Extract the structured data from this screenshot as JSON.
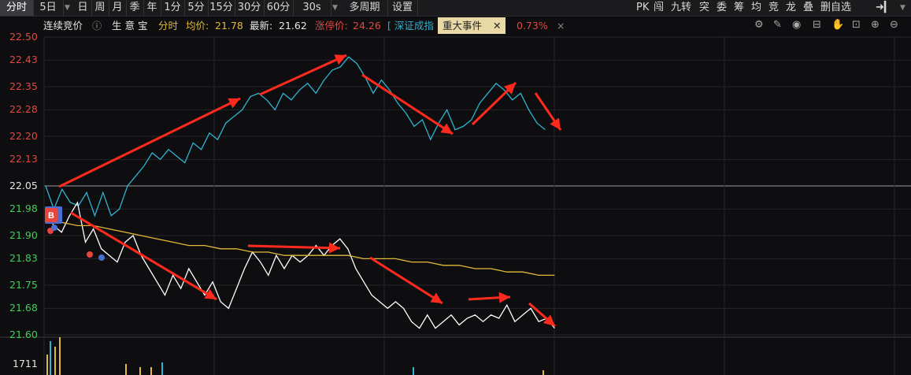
{
  "tabs": [
    {
      "label": "分时",
      "active": true
    },
    {
      "label": "5日",
      "active": false,
      "dropdown": true
    },
    {
      "label": "日",
      "active": false
    },
    {
      "label": "周",
      "active": false
    },
    {
      "label": "月",
      "active": false
    },
    {
      "label": "季",
      "active": false
    },
    {
      "label": "年",
      "active": false
    },
    {
      "label": "1分",
      "active": false
    },
    {
      "label": "5分",
      "active": false
    },
    {
      "label": "15分",
      "active": false
    },
    {
      "label": "30分",
      "active": false
    },
    {
      "label": "60分",
      "active": false
    },
    {
      "label": "30s",
      "active": false,
      "dropdown": true
    },
    {
      "label": "多周期",
      "active": false
    },
    {
      "label": "设置",
      "active": false
    }
  ],
  "right_tools": [
    "PK",
    "闯",
    "九转",
    "突",
    "委",
    "筹",
    "均",
    "竞",
    "龙",
    "叠",
    "删自选"
  ],
  "info": {
    "auction": "连续竞价",
    "life_sign": "生 意 宝",
    "mode": "分时",
    "avg_label": "均价:",
    "avg_value": "21.78",
    "last_label": "最新:",
    "last_value": "21.62",
    "limit_label": "涨停价:",
    "limit_value": "24.26",
    "index_link": "[ 深证成指",
    "event_label": "重大事件",
    "index_change": "0.73%"
  },
  "y_ticks": [
    {
      "v": "22.50",
      "color": "#e8453c"
    },
    {
      "v": "22.43",
      "color": "#e8453c"
    },
    {
      "v": "22.35",
      "color": "#e8453c"
    },
    {
      "v": "22.28",
      "color": "#e8453c"
    },
    {
      "v": "22.20",
      "color": "#e8453c"
    },
    {
      "v": "22.13",
      "color": "#e8453c"
    },
    {
      "v": "22.05",
      "color": "#e6e6e6"
    },
    {
      "v": "21.98",
      "color": "#3fcf5a"
    },
    {
      "v": "21.90",
      "color": "#3fcf5a"
    },
    {
      "v": "21.83",
      "color": "#3fcf5a"
    },
    {
      "v": "21.75",
      "color": "#3fcf5a"
    },
    {
      "v": "21.68",
      "color": "#3fcf5a"
    },
    {
      "v": "21.60",
      "color": "#3fcf5a"
    }
  ],
  "volume_label": "1711",
  "colors": {
    "index_line": "#2fb3d0",
    "price_line": "#ffffff",
    "avg_line": "#e2b93b",
    "arrow": "#ff2a1e",
    "up": "#e8453c",
    "down": "#3fcf5a"
  },
  "chart_data": {
    "type": "line",
    "ylim": [
      21.6,
      22.5
    ],
    "series": [
      {
        "values": [
          21.98,
          21.93,
          21.91,
          21.96,
          22.0,
          21.88,
          21.92,
          21.86,
          21.84,
          21.82,
          21.88,
          21.9,
          21.84,
          21.8,
          21.76,
          21.72,
          21.78,
          21.74,
          21.8,
          21.76,
          21.72,
          21.76,
          21.7,
          21.68,
          21.74,
          21.8,
          21.85,
          21.82,
          21.78,
          21.84,
          21.8,
          21.84,
          21.82,
          21.84,
          21.87,
          21.84,
          21.87,
          21.89,
          21.86,
          21.8,
          21.76,
          21.72,
          21.7,
          21.68,
          21.7,
          21.68,
          21.64,
          21.62,
          21.66,
          21.62,
          21.64,
          21.66,
          21.63,
          21.65,
          21.66,
          21.64,
          21.66,
          21.65,
          21.69,
          21.64,
          21.66,
          21.68,
          21.64,
          21.65,
          21.62
        ]
      },
      {
        "values": [
          21.95,
          21.94,
          21.93,
          21.93,
          21.92,
          21.91,
          21.9,
          21.89,
          21.88,
          21.87,
          21.87,
          21.86,
          21.86,
          21.85,
          21.85,
          21.84,
          21.84,
          21.84,
          21.84,
          21.84,
          21.83,
          21.83,
          21.83,
          21.82,
          21.82,
          21.81,
          21.81,
          21.8,
          21.8,
          21.79,
          21.79,
          21.78,
          21.78
        ]
      }
    ]
  }
}
